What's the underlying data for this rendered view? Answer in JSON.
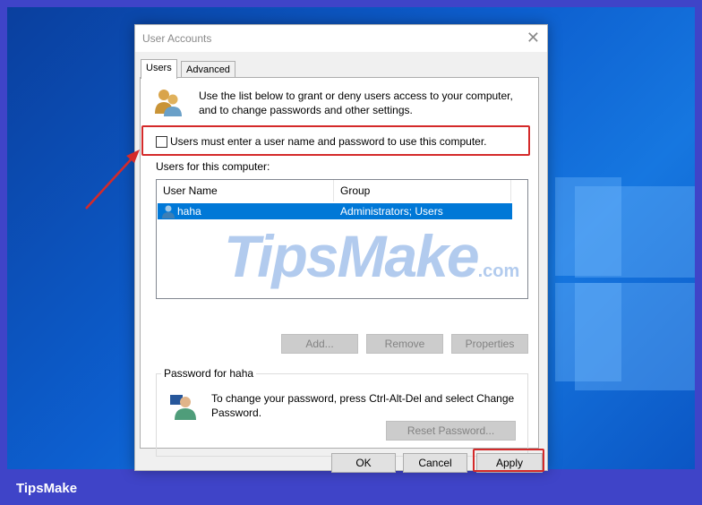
{
  "dialog": {
    "title": "User Accounts",
    "tabs": [
      {
        "label": "Users",
        "active": true
      },
      {
        "label": "Advanced",
        "active": false
      }
    ],
    "intro_line1": "Use the list below to grant or deny users access to your computer,",
    "intro_line2": "and to change passwords and other settings.",
    "require_password_label": "Users must enter a user name and password to use this computer.",
    "require_password_checked": false,
    "users_label": "Users for this computer:",
    "columns": {
      "user_name": "User Name",
      "group": "Group"
    },
    "rows": [
      {
        "user_name": "haha",
        "group": "Administrators; Users",
        "selected": true
      }
    ],
    "buttons": {
      "add": "Add...",
      "remove": "Remove",
      "properties": "Properties",
      "reset_password": "Reset Password..."
    },
    "password_group_title": "Password for haha",
    "password_text_line1": "To change your password, press Ctrl-Alt-Del and select Change",
    "password_text_line2": "Password.",
    "footer_buttons": {
      "ok": "OK",
      "cancel": "Cancel",
      "apply": "Apply"
    }
  },
  "watermark": {
    "main": "TipsMake",
    "suffix": ".com"
  },
  "footer": {
    "brand": "TipsMake"
  },
  "colors": {
    "selection": "#0078d7",
    "highlight": "#d42a2a",
    "border_frame": "#3f44c8"
  }
}
